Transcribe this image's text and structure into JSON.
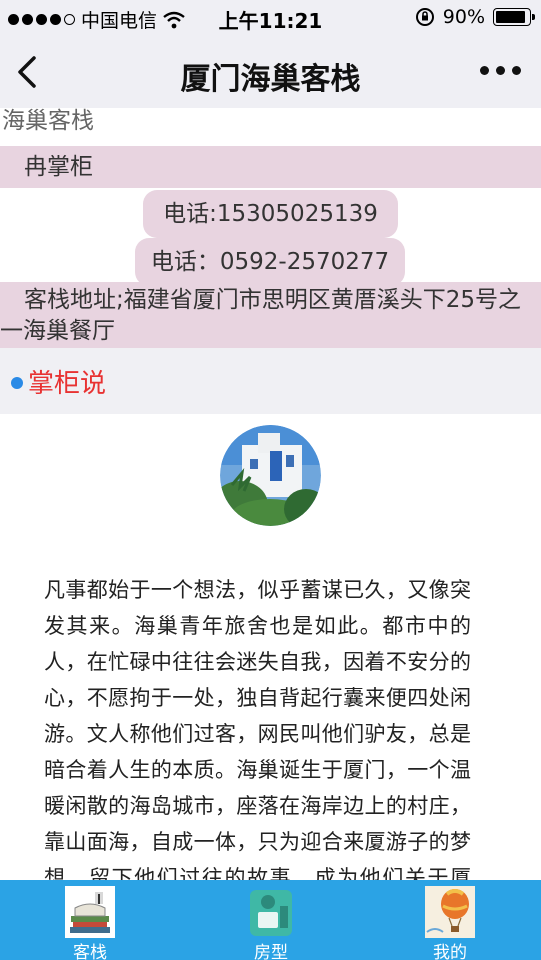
{
  "status_bar": {
    "carrier": "中国电信",
    "time": "上午11:21",
    "battery": "90%",
    "battery_level": 0.9
  },
  "nav": {
    "title": "厦门海巢客栈",
    "back_icon": "chevron-left-icon",
    "more_icon": "more-dots-icon"
  },
  "inn": {
    "name": "海巢客栈",
    "owner": "冉掌柜",
    "phone1": "电话:15305025139",
    "phone2": "电话：0592-2570277",
    "address": "客栈地址;福建省厦门市思明区黄厝溪头下25号之一海巢餐厅"
  },
  "section": {
    "title": "掌柜说"
  },
  "story": "凡事都始于一个想法，似乎蓄谋已久，又像突发其来。海巢青年旅舍也是如此。都市中的人，在忙碌中往往会迷失自我，因着不安分的心，不愿拘于一处，独自背起行囊来便四处闲游。文人称他们过客，网民叫他们驴友，总是暗合着人生的本质。海巢诞生于厦门，一个温暖闲散的海岛城市，座落在海岸边上的村庄，靠山面海，自成一体，只为迎合来厦游子的梦想，留下他们过往的故事，成为他们关于厦门，关于海与巢的回忆。",
  "tabs": [
    {
      "label": "客栈",
      "icon": "books-icon"
    },
    {
      "label": "房型",
      "icon": "room-icon"
    },
    {
      "label": "我的",
      "icon": "balloon-icon"
    }
  ],
  "colors": {
    "bar_bg": "#efeff4",
    "pink": "#e8d4e0",
    "accent_red": "#e83232",
    "tab_blue": "#2ba3e5",
    "dot_blue": "#2a8ae6"
  }
}
